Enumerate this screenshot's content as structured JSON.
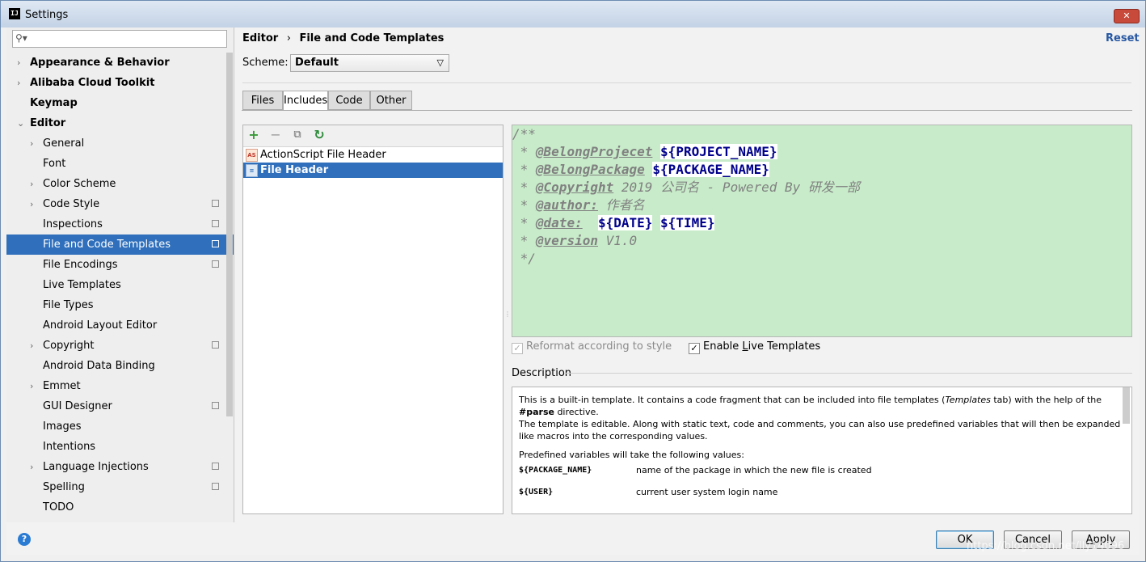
{
  "window": {
    "title": "Settings",
    "app_icon": "IJ"
  },
  "search": {
    "value": "",
    "placeholder": ""
  },
  "sidebar": {
    "items": [
      {
        "label": "Appearance & Behavior",
        "arrow": "›",
        "bold": true
      },
      {
        "label": "Alibaba Cloud Toolkit",
        "arrow": "›",
        "bold": true
      },
      {
        "label": "Keymap",
        "bold": true
      },
      {
        "label": "Editor",
        "arrow": "⌄",
        "bold": true
      },
      {
        "label": "General",
        "arrow": "›"
      },
      {
        "label": "Font"
      },
      {
        "label": "Color Scheme",
        "arrow": "›"
      },
      {
        "label": "Code Style",
        "arrow": "›",
        "project": true
      },
      {
        "label": "Inspections",
        "project": true
      },
      {
        "label": "File and Code Templates",
        "project": true,
        "selected": true
      },
      {
        "label": "File Encodings",
        "project": true
      },
      {
        "label": "Live Templates"
      },
      {
        "label": "File Types"
      },
      {
        "label": "Android Layout Editor"
      },
      {
        "label": "Copyright",
        "arrow": "›",
        "project": true
      },
      {
        "label": "Android Data Binding"
      },
      {
        "label": "Emmet",
        "arrow": "›"
      },
      {
        "label": "GUI Designer",
        "project": true
      },
      {
        "label": "Images"
      },
      {
        "label": "Intentions"
      },
      {
        "label": "Language Injections",
        "arrow": "›",
        "project": true
      },
      {
        "label": "Spelling",
        "project": true
      },
      {
        "label": "TODO"
      }
    ]
  },
  "header": {
    "breadcrumb_parent": "Editor",
    "breadcrumb_sep": "›",
    "breadcrumb_current": "File and Code Templates",
    "reset_label": "Reset"
  },
  "scheme": {
    "label": "Scheme:",
    "value": "Default"
  },
  "tabs": [
    {
      "label": "Files"
    },
    {
      "label": "Includes",
      "active": true
    },
    {
      "label": "Code"
    },
    {
      "label": "Other"
    }
  ],
  "toolbar": {
    "add": "+",
    "remove": "−",
    "copy": "⧉",
    "reset": "↻"
  },
  "templates": [
    {
      "name": "ActionScript File Header",
      "icon": "AS"
    },
    {
      "name": "File Header",
      "icon": "≡",
      "selected": true
    }
  ],
  "editor": {
    "lines": [
      [
        {
          "t": "/**",
          "s": "comment"
        }
      ],
      [
        {
          "t": " * ",
          "s": "comment"
        },
        {
          "t": "@BelongProjecet",
          "s": "tag"
        },
        {
          "t": " ",
          "s": "comment"
        },
        {
          "t": "${PROJECT_NAME}",
          "s": "var"
        }
      ],
      [
        {
          "t": " * ",
          "s": "comment"
        },
        {
          "t": "@BelongPackage",
          "s": "tag"
        },
        {
          "t": " ",
          "s": "comment"
        },
        {
          "t": "${PACKAGE_NAME}",
          "s": "var"
        }
      ],
      [
        {
          "t": " * ",
          "s": "comment"
        },
        {
          "t": "@Copyright",
          "s": "tag"
        },
        {
          "t": " 2019 公司名 - Powered By 研发一部",
          "s": "comment"
        }
      ],
      [
        {
          "t": " * ",
          "s": "comment"
        },
        {
          "t": "@author:",
          "s": "tag"
        },
        {
          "t": " 作者名",
          "s": "comment"
        }
      ],
      [
        {
          "t": " * ",
          "s": "comment"
        },
        {
          "t": "@date:",
          "s": "tag"
        },
        {
          "t": "  ",
          "s": "comment"
        },
        {
          "t": "${DATE}",
          "s": "var"
        },
        {
          "t": " ",
          "s": "comment"
        },
        {
          "t": "${TIME}",
          "s": "var"
        }
      ],
      [
        {
          "t": " * ",
          "s": "comment"
        },
        {
          "t": "@version",
          "s": "tag"
        },
        {
          "t": " V1.0",
          "s": "comment"
        }
      ],
      [
        {
          "t": " */",
          "s": "comment"
        }
      ]
    ]
  },
  "options": {
    "reformat_label": "Reformat according to style",
    "reformat_checked": true,
    "reformat_enabled": false,
    "live_templates_label_pre": "Enable ",
    "live_templates_label_u": "L",
    "live_templates_label_post": "ive Templates",
    "live_templates_checked": true
  },
  "description": {
    "heading": "Description",
    "p1_a": "This is a built-in template. It contains a code fragment that can be included into file templates (",
    "p1_em": "Templates",
    "p1_b": " tab) with the help of the",
    "p1_c": "#parse",
    "p1_d": " directive.",
    "p2": "The template is editable. Along with static text, code and comments, you can also use predefined variables that will then be expanded like macros into the corresponding values.",
    "p3": "Predefined variables will take the following values:",
    "vars": [
      {
        "name": "${PACKAGE_NAME}",
        "desc": "name of the package in which the new file is created"
      },
      {
        "name": "${USER}",
        "desc": "current user system login name"
      }
    ]
  },
  "footer": {
    "help": "?",
    "ok": "OK",
    "cancel": "Cancel",
    "apply_u": "A",
    "apply_rest": "pply"
  },
  "watermark": "https://blog.csdn.net/lly14096"
}
